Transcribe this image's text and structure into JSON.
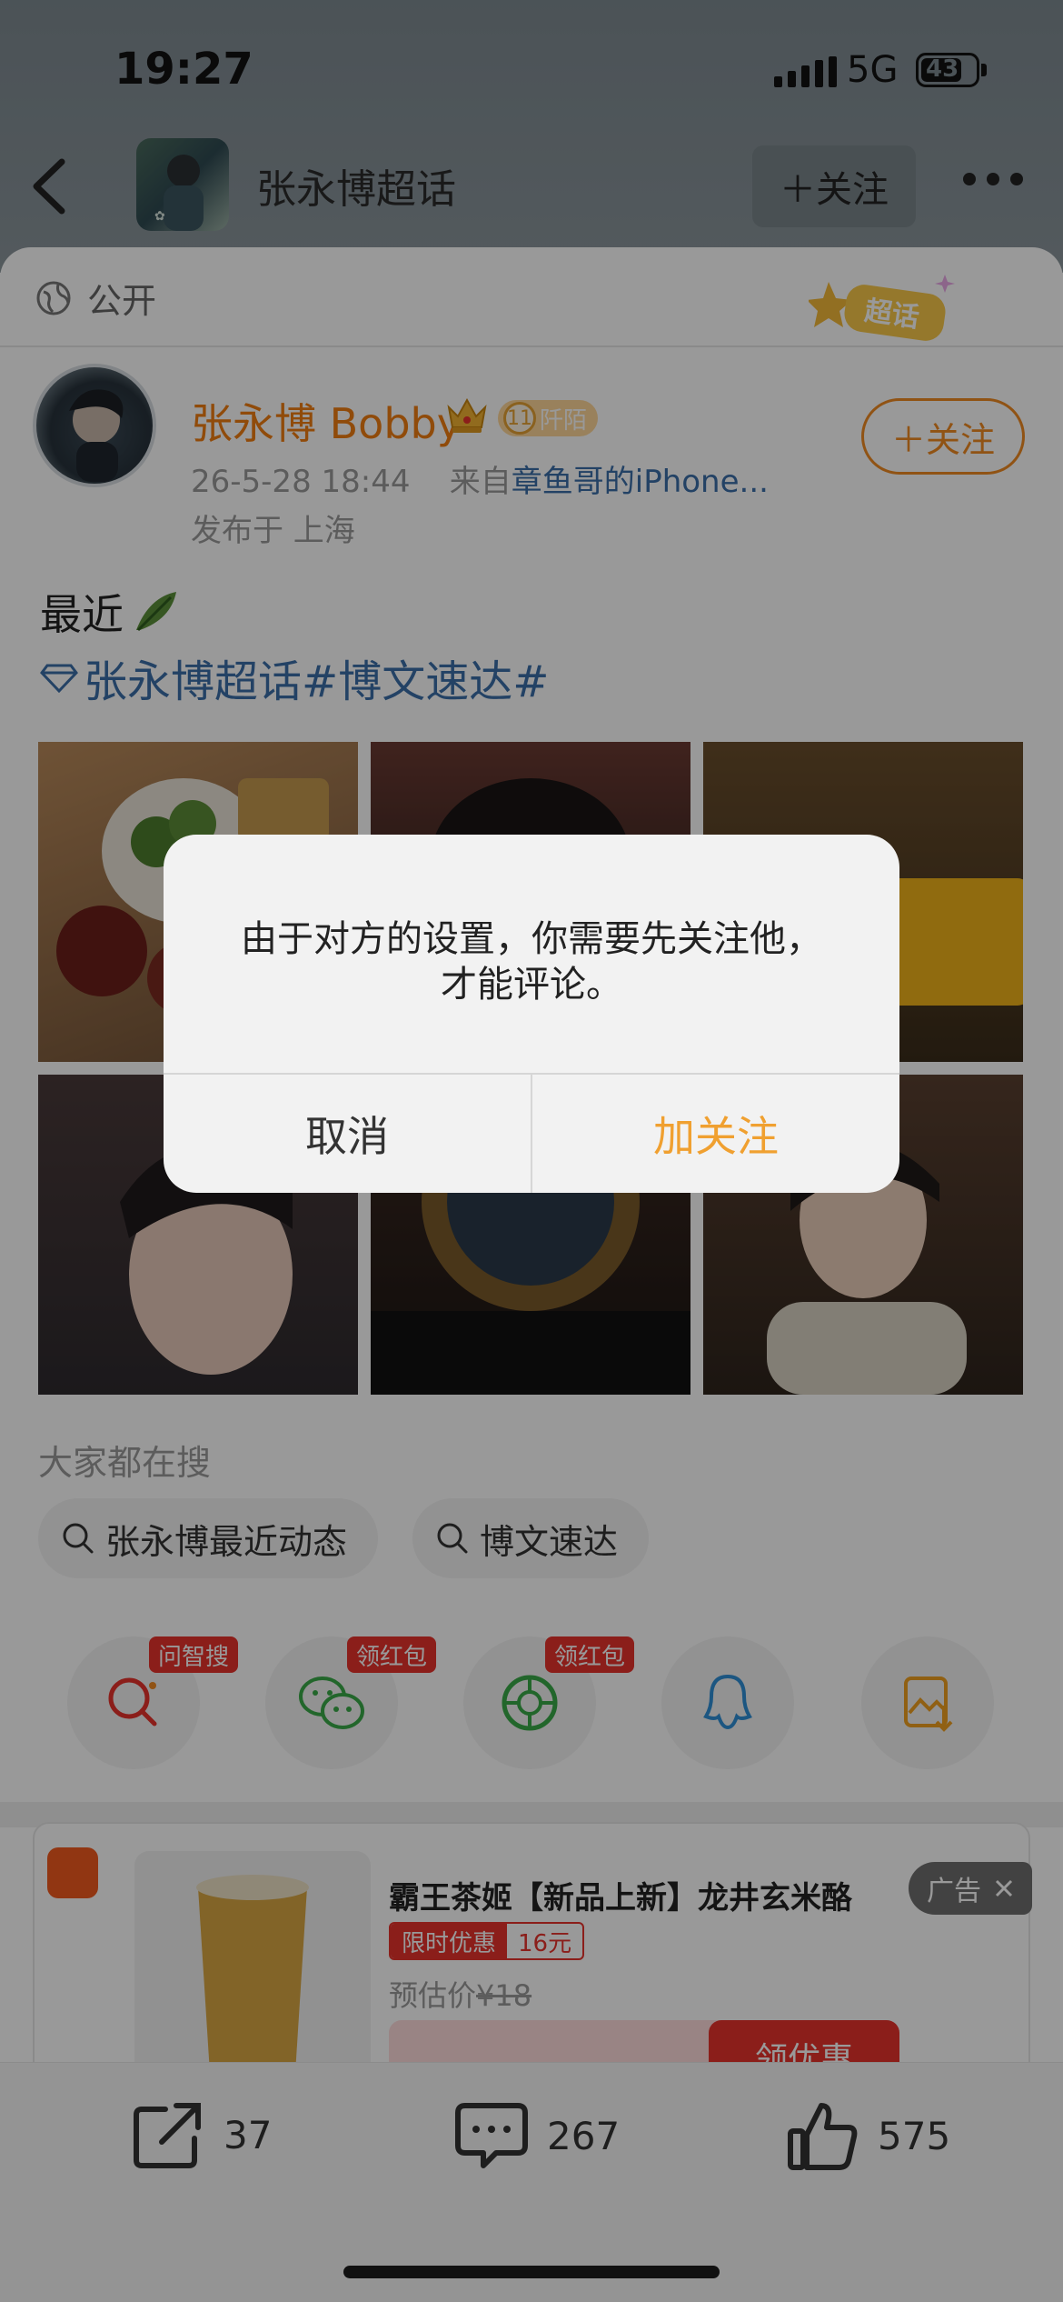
{
  "status": {
    "time": "19:27",
    "network": "5G",
    "battery": "43"
  },
  "nav": {
    "title": "张永博超话",
    "follow_label": "＋关注"
  },
  "post": {
    "visibility": "公开",
    "author": "张永博 Bobby",
    "level": "11",
    "level_label": "阡陌",
    "follow_label": "＋关注",
    "date": "26-5-28 18:44",
    "from_prefix": "来自",
    "device": "章鱼哥的iPhone...",
    "location": "发布于 上海",
    "text": "最近",
    "hashtag": "张永博超话#博文速达#"
  },
  "search": {
    "label": "大家都在搜",
    "chips": [
      "张永博最近动态",
      "博文速达"
    ]
  },
  "share_tags": [
    "问智搜",
    "领红包",
    "领红包"
  ],
  "ad": {
    "title": "霸王茶姬【新品上新】龙井玄米酪",
    "limit_label": "限时优惠",
    "limit_value": "16元",
    "est_label": "预估价",
    "est_price": "¥18",
    "tag": "广告",
    "coupon_label": "领优惠"
  },
  "actions": {
    "reposts": "37",
    "comments": "267",
    "likes": "575"
  },
  "dialog": {
    "message_line1": "由于对方的设置，你需要先关注他，",
    "message_line2": "才能评论。",
    "cancel_label": "取消",
    "confirm_label": "加关注"
  },
  "colors": {
    "accent": "#f08a22",
    "link": "#3b6ea8",
    "confirm": "#f0a030"
  }
}
